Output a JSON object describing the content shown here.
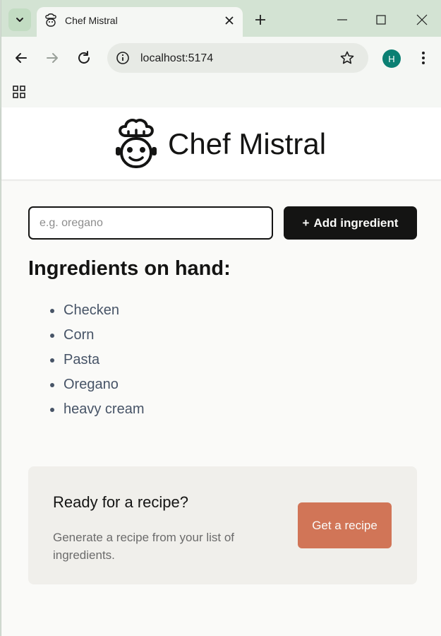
{
  "browser": {
    "tab_title": "Chef Mistral",
    "url": "localhost:5174",
    "profile_initial": "H",
    "icons": {
      "tab_search": "chevron-down-icon",
      "new_tab": "plus-icon",
      "back": "arrow-left-icon",
      "forward": "arrow-right-icon",
      "reload": "reload-icon",
      "site_info": "info-icon",
      "bookmark": "star-icon",
      "menu": "kebab-menu-icon",
      "apps": "apps-grid-icon"
    }
  },
  "header": {
    "title": "Chef Mistral",
    "logo_icon": "chef-hat-icon"
  },
  "form": {
    "placeholder": "e.g. oregano",
    "value": "",
    "add_button_icon": "+",
    "add_button_label": "Add ingredient"
  },
  "ingredients": {
    "heading": "Ingredients on hand:",
    "items": [
      "Checken",
      "Corn",
      "Pasta",
      "Oregano",
      "heavy cream"
    ]
  },
  "recipe_card": {
    "title": "Ready for a recipe?",
    "description": "Generate a recipe from your list of ingredients.",
    "button_label": "Get a recipe"
  },
  "colors": {
    "accent_button": "#d17557",
    "dark_button": "#141413",
    "profile_avatar": "#0b8073",
    "card_background": "#f0efeb"
  }
}
